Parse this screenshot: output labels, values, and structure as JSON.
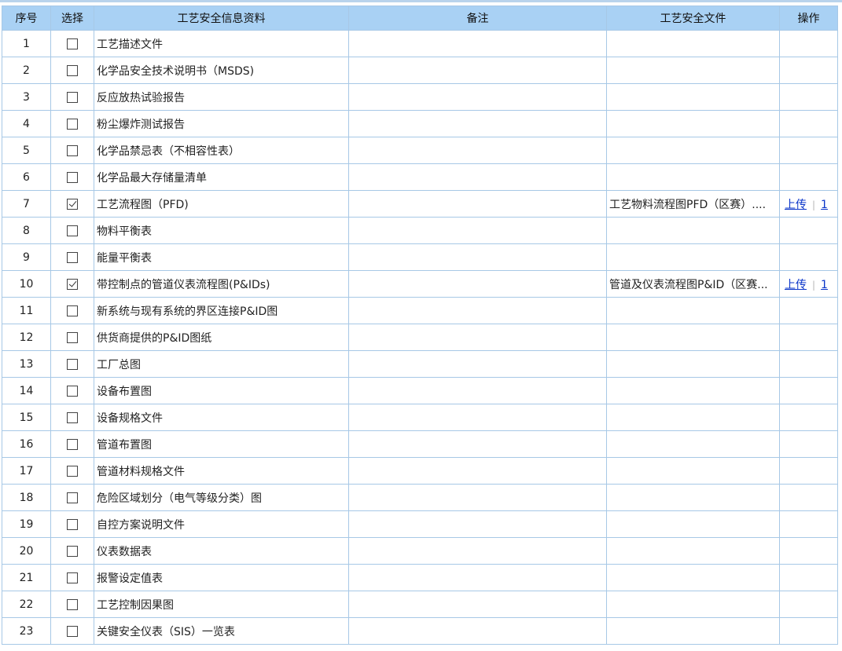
{
  "headers": {
    "index": "序号",
    "select": "选择",
    "info": "工艺安全信息资料",
    "remark": "备注",
    "file": "工艺安全文件",
    "action": "操作"
  },
  "rows": [
    {
      "index": "1",
      "checked": false,
      "name": "工艺描述文件",
      "remark": "",
      "file": "",
      "upload": "",
      "count": ""
    },
    {
      "index": "2",
      "checked": false,
      "name": "化学品安全技术说明书（MSDS)",
      "remark": "",
      "file": "",
      "upload": "",
      "count": ""
    },
    {
      "index": "3",
      "checked": false,
      "name": "反应放热试验报告",
      "remark": "",
      "file": "",
      "upload": "",
      "count": ""
    },
    {
      "index": "4",
      "checked": false,
      "name": "粉尘爆炸测试报告",
      "remark": "",
      "file": "",
      "upload": "",
      "count": ""
    },
    {
      "index": "5",
      "checked": false,
      "name": "化学品禁忌表（不相容性表）",
      "remark": "",
      "file": "",
      "upload": "",
      "count": ""
    },
    {
      "index": "6",
      "checked": false,
      "name": "化学品最大存储量清单",
      "remark": "",
      "file": "",
      "upload": "",
      "count": ""
    },
    {
      "index": "7",
      "checked": true,
      "name": "工艺流程图（PFD)",
      "remark": "",
      "file": "工艺物料流程图PFD（区赛）....",
      "upload": "上传",
      "count": "1"
    },
    {
      "index": "8",
      "checked": false,
      "name": "物料平衡表",
      "remark": "",
      "file": "",
      "upload": "",
      "count": ""
    },
    {
      "index": "9",
      "checked": false,
      "name": "能量平衡表",
      "remark": "",
      "file": "",
      "upload": "",
      "count": ""
    },
    {
      "index": "10",
      "checked": true,
      "name": "带控制点的管道仪表流程图(P&IDs)",
      "remark": "",
      "file": "管道及仪表流程图P&ID（区赛...",
      "upload": "上传",
      "count": "1"
    },
    {
      "index": "11",
      "checked": false,
      "name": "新系统与现有系统的界区连接P&ID图",
      "remark": "",
      "file": "",
      "upload": "",
      "count": ""
    },
    {
      "index": "12",
      "checked": false,
      "name": "供货商提供的P&ID图纸",
      "remark": "",
      "file": "",
      "upload": "",
      "count": ""
    },
    {
      "index": "13",
      "checked": false,
      "name": "工厂总图",
      "remark": "",
      "file": "",
      "upload": "",
      "count": ""
    },
    {
      "index": "14",
      "checked": false,
      "name": "设备布置图",
      "remark": "",
      "file": "",
      "upload": "",
      "count": ""
    },
    {
      "index": "15",
      "checked": false,
      "name": "设备规格文件",
      "remark": "",
      "file": "",
      "upload": "",
      "count": ""
    },
    {
      "index": "16",
      "checked": false,
      "name": "管道布置图",
      "remark": "",
      "file": "",
      "upload": "",
      "count": ""
    },
    {
      "index": "17",
      "checked": false,
      "name": "管道材料规格文件",
      "remark": "",
      "file": "",
      "upload": "",
      "count": ""
    },
    {
      "index": "18",
      "checked": false,
      "name": "危险区域划分（电气等级分类）图",
      "remark": "",
      "file": "",
      "upload": "",
      "count": ""
    },
    {
      "index": "19",
      "checked": false,
      "name": "自控方案说明文件",
      "remark": "",
      "file": "",
      "upload": "",
      "count": ""
    },
    {
      "index": "20",
      "checked": false,
      "name": "仪表数据表",
      "remark": "",
      "file": "",
      "upload": "",
      "count": ""
    },
    {
      "index": "21",
      "checked": false,
      "name": "报警设定值表",
      "remark": "",
      "file": "",
      "upload": "",
      "count": ""
    },
    {
      "index": "22",
      "checked": false,
      "name": "工艺控制因果图",
      "remark": "",
      "file": "",
      "upload": "",
      "count": ""
    },
    {
      "index": "23",
      "checked": false,
      "name": "关键安全仪表（SIS）一览表",
      "remark": "",
      "file": "",
      "upload": "",
      "count": ""
    }
  ]
}
